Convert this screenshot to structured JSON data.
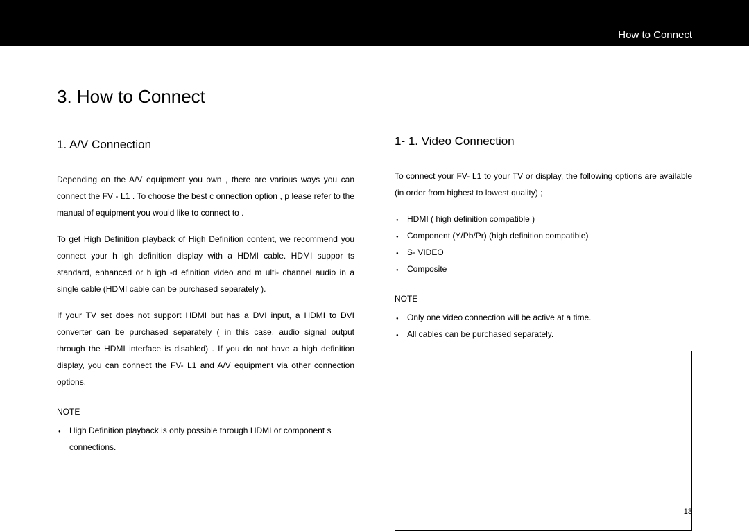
{
  "header": {
    "section_title": "How to Connect"
  },
  "main_heading": "3.  How to Connect",
  "left_column": {
    "heading": "1.  A/V Connection",
    "para1": "Depending on the    A/V equipment   you own , there are various ways you can connect the FV   - L1 .   To choose the best c  onnection   option , p lease refer to the manual of     equipment   you would like to connect to    .",
    "para2": "To  get  High  Definition  playback  of  High  Definition  content,  we  recommend   you connect your h    igh  definition display with a HDMI cable. HDMI suppor ts standard,  enhanced or  h igh -d efinition  video and  m ulti- channel   audio  in  a  single  cable  (HDMI  cable      can  be  purchased  separately  ).",
    "para3": "If your TV set   does not support HDMI but has a DVI input, a HDMI to DVI  converter can be purchased separately (       in this case,  audio signal output   through the HDMI interface     is disabled)  .  If you do not have a high  definition display, you can connect the        FV- L1 and A/V equipment via other connection options.",
    "note_label": "NOTE",
    "note_items": [
      "High   Definition   playback   is   only   possible   through   HDMI   or   component  s connections."
    ]
  },
  "right_column": {
    "heading": "1- 1.  Video   Connection",
    "para1": "To connect your    FV- L1 to your TV or display, the following       options   are available (in order from highest to lowest quality)          ;",
    "list_items": [
      "HDMI (  high definition compatible     )",
      "Component (Y/Pb/Pr)      (high definition compatible)",
      "S- VIDEO",
      "Composite"
    ],
    "note_label": "NOTE",
    "note_items": [
      "Only one video   connection   will be active at a time.",
      "All cables can be purchased separately."
    ]
  },
  "page_number": "13"
}
